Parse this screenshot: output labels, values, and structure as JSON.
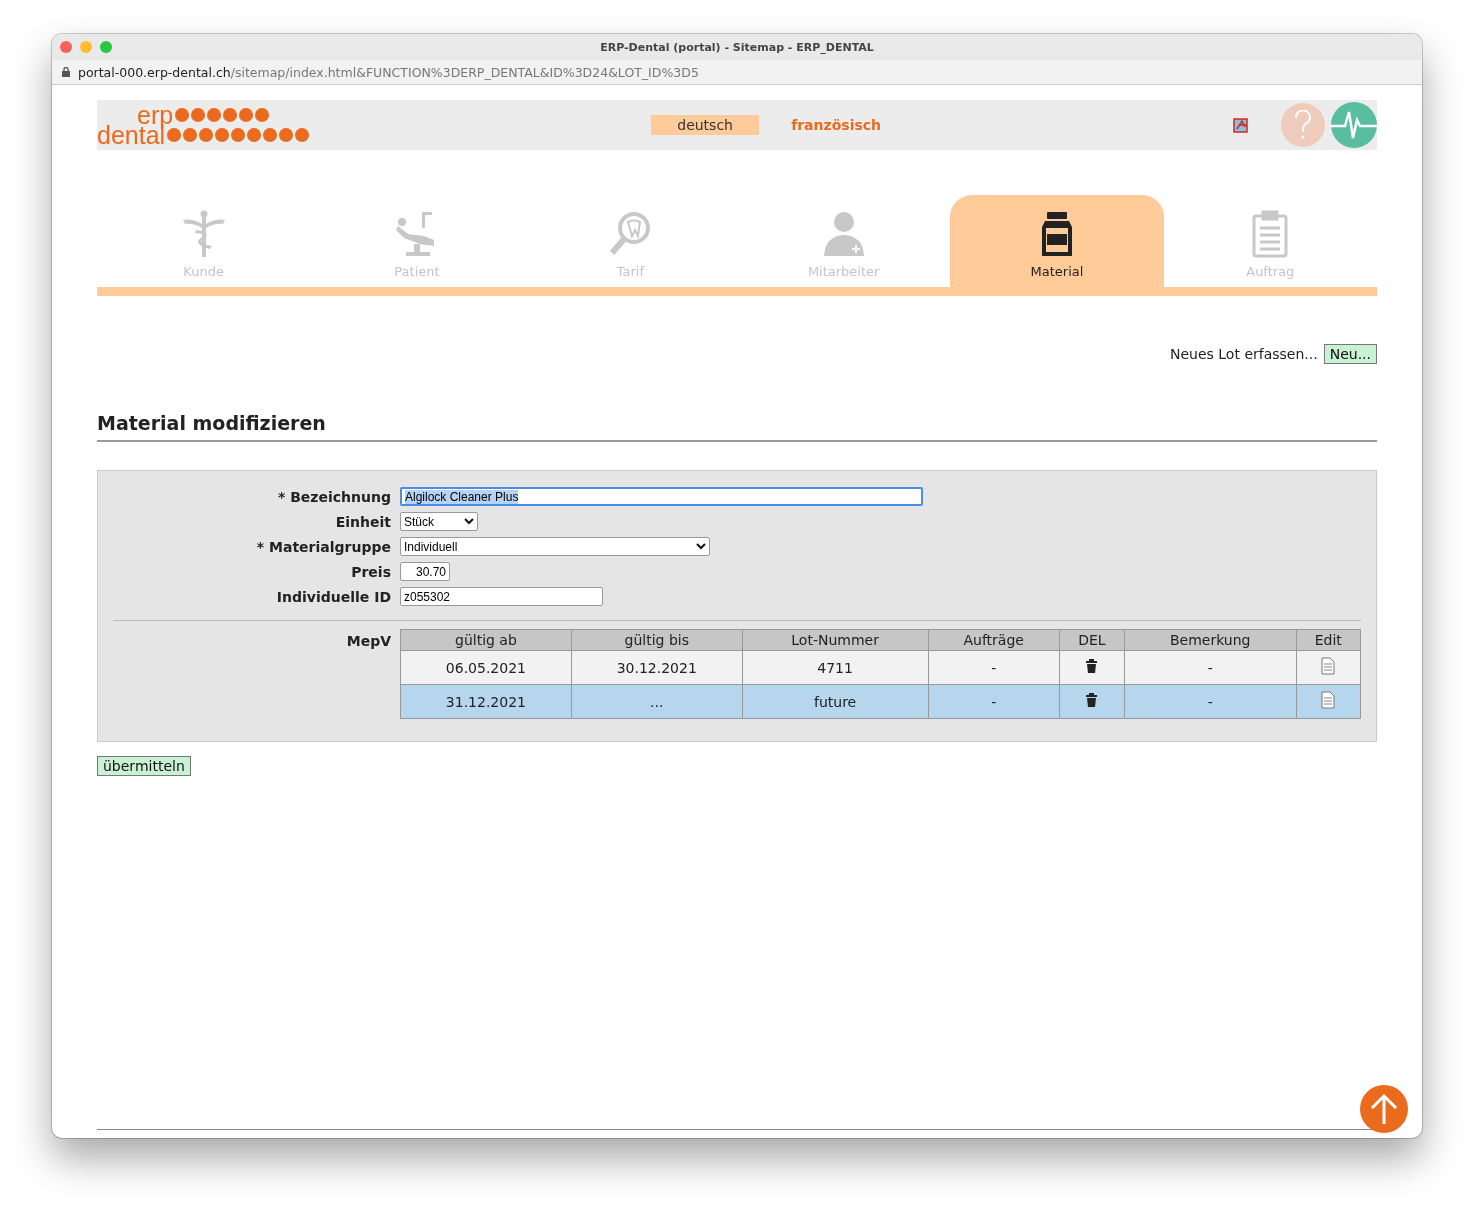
{
  "window": {
    "title": "ERP-Dental (portal) - Sitemap - ERP_DENTAL",
    "url_host": "portal-000.erp-dental.ch",
    "url_path": "/sitemap/index.html&FUNCTION%3DERP_DENTAL&ID%3D24&LOT_ID%3D5"
  },
  "header": {
    "logo": [
      "erp",
      "dental"
    ],
    "languages": [
      {
        "label": "deutsch",
        "selected": true
      },
      {
        "label": "französisch",
        "selected": false
      }
    ]
  },
  "nav_tabs": [
    {
      "label": "Kunde",
      "kind": "caduceus",
      "selected": false
    },
    {
      "label": "Patient",
      "kind": "chair",
      "selected": false
    },
    {
      "label": "Tarif",
      "kind": "magnifier",
      "selected": false
    },
    {
      "label": "Mitarbeiter",
      "kind": "person",
      "selected": false
    },
    {
      "label": "Material",
      "kind": "jar",
      "selected": true
    },
    {
      "label": "Auftrag",
      "kind": "clipboard",
      "selected": false
    }
  ],
  "new_lot": {
    "label": "Neues Lot erfassen...",
    "button": "Neu..."
  },
  "section_title": "Material modifizieren",
  "form": {
    "fields": [
      {
        "label": "* Bezeichnung",
        "kind": "text",
        "value": "Algilock Cleaner Plus",
        "focused": true
      },
      {
        "label": "Einheit",
        "kind": "select",
        "value": "Stück"
      },
      {
        "label": "* Materialgruppe",
        "kind": "select",
        "value": "Individuell"
      },
      {
        "label": "Preis",
        "kind": "number",
        "value": "30.70"
      },
      {
        "label": "Individuelle ID",
        "kind": "text",
        "value": "z055302"
      }
    ],
    "table_label": "MepV",
    "table": {
      "columns": [
        "gültig ab",
        "gültig bis",
        "Lot-Nummer",
        "Aufträge",
        "DEL",
        "Bemerkung",
        "Edit"
      ],
      "rows": [
        {
          "gueltig_ab": "06.05.2021",
          "gueltig_bis": "30.12.2021",
          "lot_nummer": "4711",
          "auftraege": "-",
          "bemerkung": "-",
          "selected": false
        },
        {
          "gueltig_ab": "31.12.2021",
          "gueltig_bis": "...",
          "lot_nummer": "future",
          "auftraege": "-",
          "bemerkung": "-",
          "selected": true
        }
      ]
    }
  },
  "submit": "übermitteln"
}
